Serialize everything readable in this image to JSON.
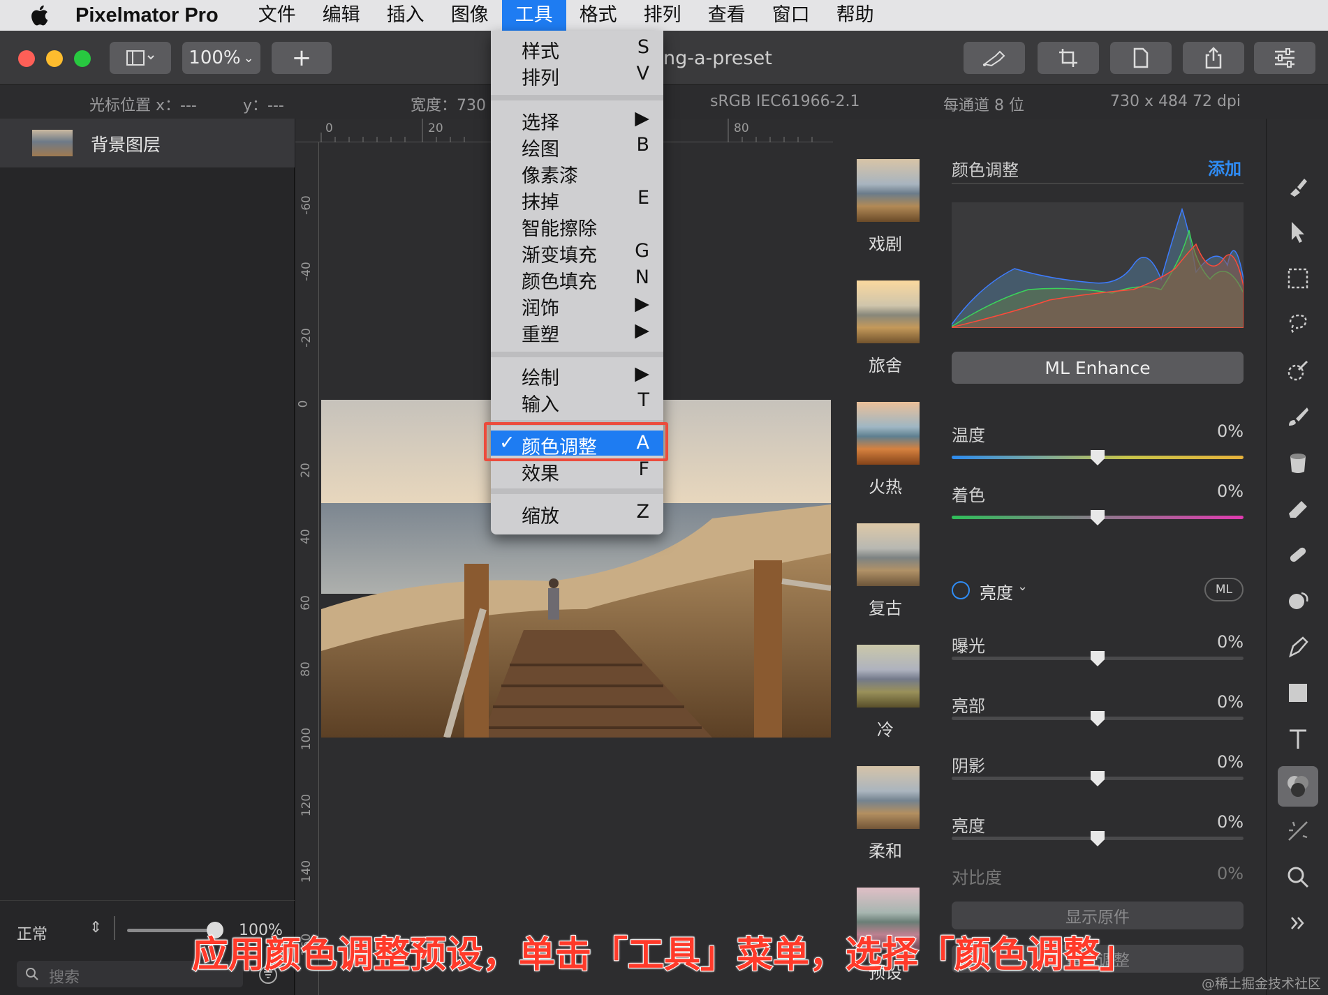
{
  "menubar": {
    "app_name": "Pixelmator Pro",
    "items": [
      "文件",
      "编辑",
      "插入",
      "图像",
      "工具",
      "格式",
      "排列",
      "查看",
      "窗口",
      "帮助"
    ]
  },
  "toolbar": {
    "zoom": "100%",
    "add": "+",
    "document_title": "ng-a-preset"
  },
  "infobar": {
    "cursor_x": "光标位置 x：---",
    "cursor_y": "y：---",
    "width": "宽度：730",
    "color_profile": "sRGB IEC61966-2.1",
    "bit_depth": "每通道 8 位",
    "dims": "730 x 484 72 dpi"
  },
  "layers": {
    "name": "背景图层",
    "blend_mode": "正常",
    "opacity": "100%",
    "search_placeholder": "搜索"
  },
  "ruler": {
    "top": [
      "0",
      "20",
      "80"
    ],
    "left": [
      "-60",
      "-40",
      "-20",
      "0",
      "20",
      "40",
      "60",
      "80",
      "100",
      "120",
      "140",
      "160"
    ]
  },
  "tools_menu": {
    "items": [
      {
        "label": "样式",
        "shortcut": "S"
      },
      {
        "label": "排列",
        "shortcut": "V"
      },
      {
        "label": "选择",
        "shortcut": "▶"
      },
      {
        "label": "绘图",
        "shortcut": "B"
      },
      {
        "label": "像素漆",
        "shortcut": ""
      },
      {
        "label": "抹掉",
        "shortcut": "E"
      },
      {
        "label": "智能擦除",
        "shortcut": ""
      },
      {
        "label": "渐变填充",
        "shortcut": "G"
      },
      {
        "label": "颜色填充",
        "shortcut": "N"
      },
      {
        "label": "润饰",
        "shortcut": "▶"
      },
      {
        "label": "重塑",
        "shortcut": "▶"
      },
      {
        "label": "绘制",
        "shortcut": "▶"
      },
      {
        "label": "输入",
        "shortcut": "T"
      },
      {
        "label": "颜色调整",
        "shortcut": "A",
        "check": "✓"
      },
      {
        "label": "效果",
        "shortcut": "F"
      },
      {
        "label": "缩放",
        "shortcut": "Z"
      }
    ]
  },
  "presets": [
    "戏剧",
    "旅舍",
    "火热",
    "复古",
    "冷",
    "柔和",
    "预设"
  ],
  "adjust": {
    "title": "颜色调整",
    "add": "添加",
    "ml_enhance": "ML Enhance",
    "temperature": {
      "label": "温度",
      "value": "0%"
    },
    "tint": {
      "label": "着色",
      "value": "0%"
    },
    "brightness_section": "亮度",
    "ml_badge": "ML",
    "exposure": {
      "label": "曝光",
      "value": "0%"
    },
    "highlights": {
      "label": "亮部",
      "value": "0%"
    },
    "shadows": {
      "label": "阴影",
      "value": "0%"
    },
    "brightness": {
      "label": "亮度",
      "value": "0%"
    },
    "contrast": {
      "label": "对比度",
      "value": "0%"
    },
    "show_original": "显示原件",
    "reset": "重置调整"
  },
  "caption": "应用颜色调整预设，单击「工具」菜单，选择「颜色调整」",
  "watermark": "@稀土掘金技术社区"
}
